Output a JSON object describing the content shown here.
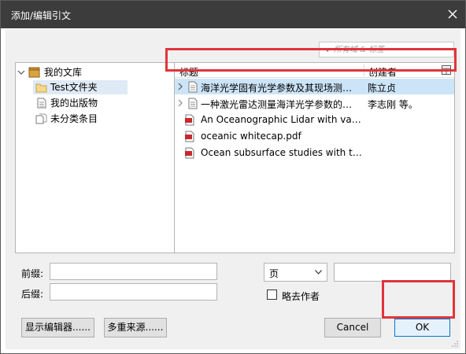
{
  "window": {
    "title": "添加/编辑引文"
  },
  "search": {
    "placeholder": "所有域 & 标签"
  },
  "tree": {
    "root_label": "我的文库",
    "items": [
      {
        "label": "Test文件夹"
      },
      {
        "label": "我的出版物"
      },
      {
        "label": "未分类条目"
      }
    ]
  },
  "list": {
    "col_title": "标题",
    "col_creator": "创建者",
    "rows": [
      {
        "title": "海洋光学固有光学参数及其现场测量...",
        "creator": "陈立贞",
        "icon": "document-icon",
        "selected": true
      },
      {
        "title": "一种激光雷达测量海洋光学参数的新...",
        "creator": "李志刚 等。",
        "icon": "document-icon",
        "selected": false
      },
      {
        "title": "An Oceanographic Lidar with vari...",
        "creator": "",
        "icon": "pdf-icon",
        "selected": false
      },
      {
        "title": "oceanic whitecap.pdf",
        "creator": "",
        "icon": "pdf-icon",
        "selected": false
      },
      {
        "title": "Ocean subsurface studies with the...",
        "creator": "",
        "icon": "pdf-icon",
        "selected": false
      }
    ]
  },
  "form": {
    "prefix_label": "前缀:",
    "prefix_value": "",
    "suffix_label": "后缀:",
    "suffix_value": "",
    "locator_value": "页",
    "locator_input_value": "",
    "suppress_author_label": "略去作者",
    "suppress_author_checked": false
  },
  "buttons": {
    "show_editor": "显示编辑器......",
    "multi_source": "多重来源......",
    "cancel": "Cancel",
    "ok": "OK"
  },
  "colors": {
    "titlebar": "#3c3c3c",
    "selection": "#cce4f7",
    "highlight": "#e1343a",
    "ok_border": "#0078d7",
    "pdf_red": "#c8282d"
  }
}
